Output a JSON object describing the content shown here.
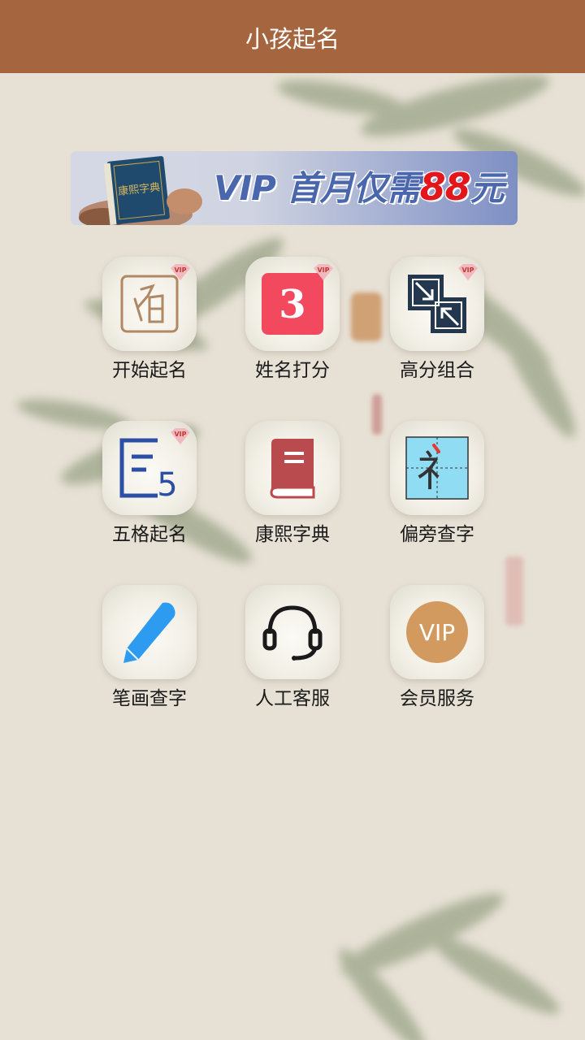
{
  "header": {
    "title": "小孩起名"
  },
  "banner": {
    "vip": "VIP",
    "text_cn": "首月仅需",
    "price": "88",
    "unit": "元",
    "book_title": "康熙字典"
  },
  "menu": [
    {
      "label": "开始起名",
      "icon": "name-seal-icon",
      "vip": true
    },
    {
      "label": "姓名打分",
      "icon": "score-3-icon",
      "vip": true,
      "icon_text": "3"
    },
    {
      "label": "高分组合",
      "icon": "combine-arrows-icon",
      "vip": true
    },
    {
      "label": "五格起名",
      "icon": "five-grid-icon",
      "vip": true,
      "icon_text": "5"
    },
    {
      "label": "康熙字典",
      "icon": "dictionary-book-icon",
      "vip": false
    },
    {
      "label": "偏旁查字",
      "icon": "radical-lookup-icon",
      "vip": false,
      "icon_text": "礻"
    },
    {
      "label": "笔画查字",
      "icon": "pencil-icon",
      "vip": false
    },
    {
      "label": "人工客服",
      "icon": "headset-icon",
      "vip": false
    },
    {
      "label": "会员服务",
      "icon": "vip-circle-icon",
      "vip": false,
      "icon_text": "VIP"
    }
  ],
  "colors": {
    "header": "#a5663f",
    "background": "#e7e1d5",
    "accent_red": "#f2495f",
    "accent_blue": "#2c4fa6",
    "vip_gold": "#d39a5f"
  }
}
